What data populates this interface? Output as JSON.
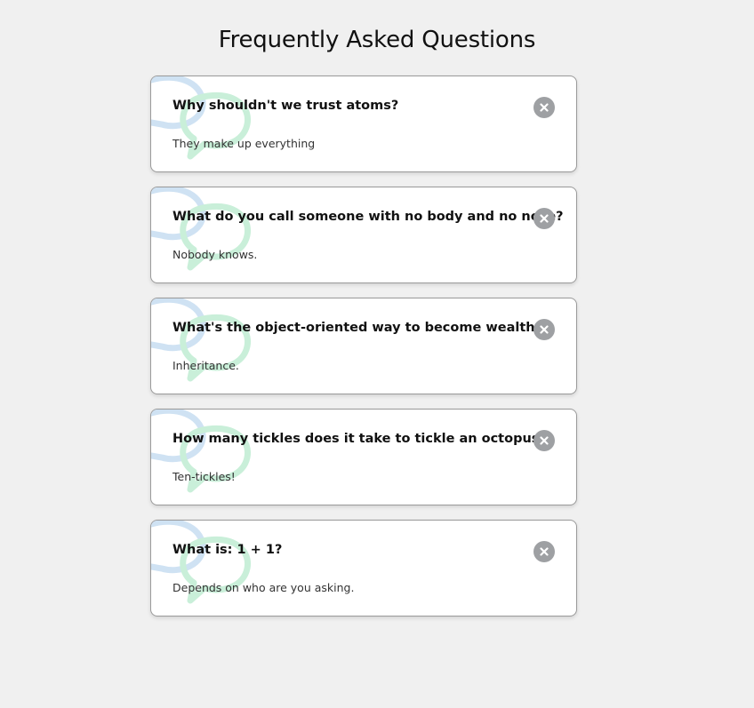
{
  "page": {
    "title": "Frequently Asked Questions"
  },
  "colors": {
    "background": "#f0f0f0",
    "card": "#ffffff",
    "toggle": "#9ea0a3",
    "bubble_blue": "#cfe2f3",
    "bubble_green": "#c9efd9"
  },
  "faqs": [
    {
      "question": "Why shouldn't we trust atoms?",
      "answer": "They make up everything",
      "toggle_icon": "close-icon"
    },
    {
      "question": "What do you call someone with no body and no nose?",
      "answer": "Nobody knows.",
      "toggle_icon": "close-icon"
    },
    {
      "question": "What's the object-oriented way to become wealthy?",
      "answer": "Inheritance.",
      "toggle_icon": "close-icon"
    },
    {
      "question": "How many tickles does it take to tickle an octopus?",
      "answer": "Ten-tickles!",
      "toggle_icon": "close-icon"
    },
    {
      "question": "What is: 1 + 1?",
      "answer": "Depends on who are you asking.",
      "toggle_icon": "close-icon"
    }
  ]
}
